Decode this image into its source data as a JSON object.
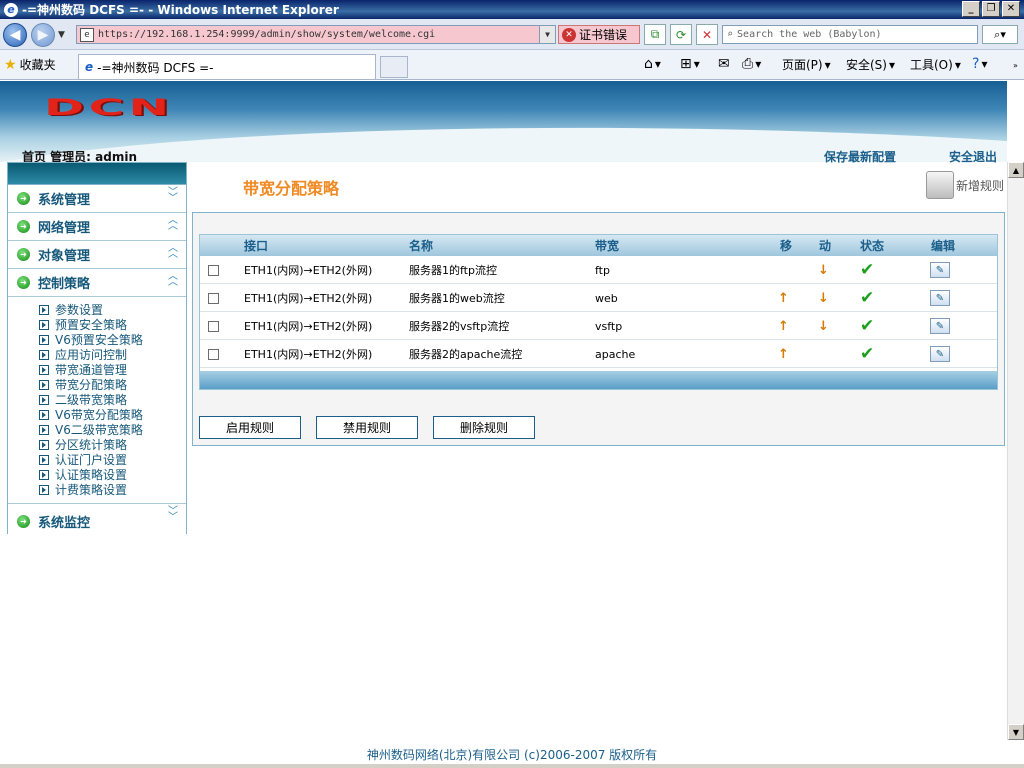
{
  "window": {
    "title": "-=神州数码 DCFS =- - Windows Internet Explorer",
    "buttons": [
      "_",
      "❐",
      "✕"
    ]
  },
  "browser": {
    "url": "https://192.168.1.254:9999/admin/show/system/welcome.cgi",
    "cert_error": "证书错误",
    "search_placeholder": "Search the web (Babylon)",
    "favorites_label": "收藏夹",
    "tab_title": "-=神州数码 DCFS =-",
    "commands": {
      "page": "页面(P)",
      "safety": "安全(S)",
      "tools": "工具(O)"
    }
  },
  "header": {
    "logo_text": "DCN",
    "breadcrumb": "首页 管理员: admin",
    "save_config": "保存最新配置",
    "logout": "安全退出"
  },
  "sidebar": {
    "sections": [
      {
        "label": "系统管理",
        "chevron": "down"
      },
      {
        "label": "网络管理",
        "chevron": "up"
      },
      {
        "label": "对象管理",
        "chevron": "up"
      },
      {
        "label": "控制策略",
        "chevron": "up"
      }
    ],
    "subitems": [
      "参数设置",
      "预置安全策略",
      "V6预置安全策略",
      "应用访问控制",
      "带宽通道管理",
      "带宽分配策略",
      "二级带宽策略",
      "V6带宽分配策略",
      "V6二级带宽策略",
      "分区统计策略",
      "认证门户设置",
      "认证策略设置",
      "计费策略设置"
    ],
    "last_section": {
      "label": "系统监控",
      "chevron": "down"
    }
  },
  "main": {
    "title": "带宽分配策略",
    "new_rule": "新增规则",
    "table": {
      "headers": {
        "iface": "接口",
        "name": "名称",
        "bw": "带宽",
        "move1": "移",
        "move2": "动",
        "status": "状态",
        "edit": "编辑"
      },
      "rows": [
        {
          "iface": "ETH1(内网)→ETH2(外网)",
          "name": "服务器1的ftp流控",
          "bw": "ftp",
          "up": false,
          "down": true
        },
        {
          "iface": "ETH1(内网)→ETH2(外网)",
          "name": "服务器1的web流控",
          "bw": "web",
          "up": true,
          "down": true
        },
        {
          "iface": "ETH1(内网)→ETH2(外网)",
          "name": "服务器2的vsftp流控",
          "bw": "vsftp",
          "up": true,
          "down": true
        },
        {
          "iface": "ETH1(内网)→ETH2(外网)",
          "name": "服务器2的apache流控",
          "bw": "apache",
          "up": true,
          "down": false
        }
      ]
    },
    "buttons": {
      "enable": "启用规则",
      "disable": "禁用规则",
      "delete": "删除规则"
    }
  },
  "footer": "神州数码网络(北京)有限公司 (c)2006-2007 版权所有",
  "colors": {
    "accent_title": "#f08a24",
    "link": "#1b5f8a",
    "banner": "#175f94",
    "logo": "#e2231a"
  }
}
